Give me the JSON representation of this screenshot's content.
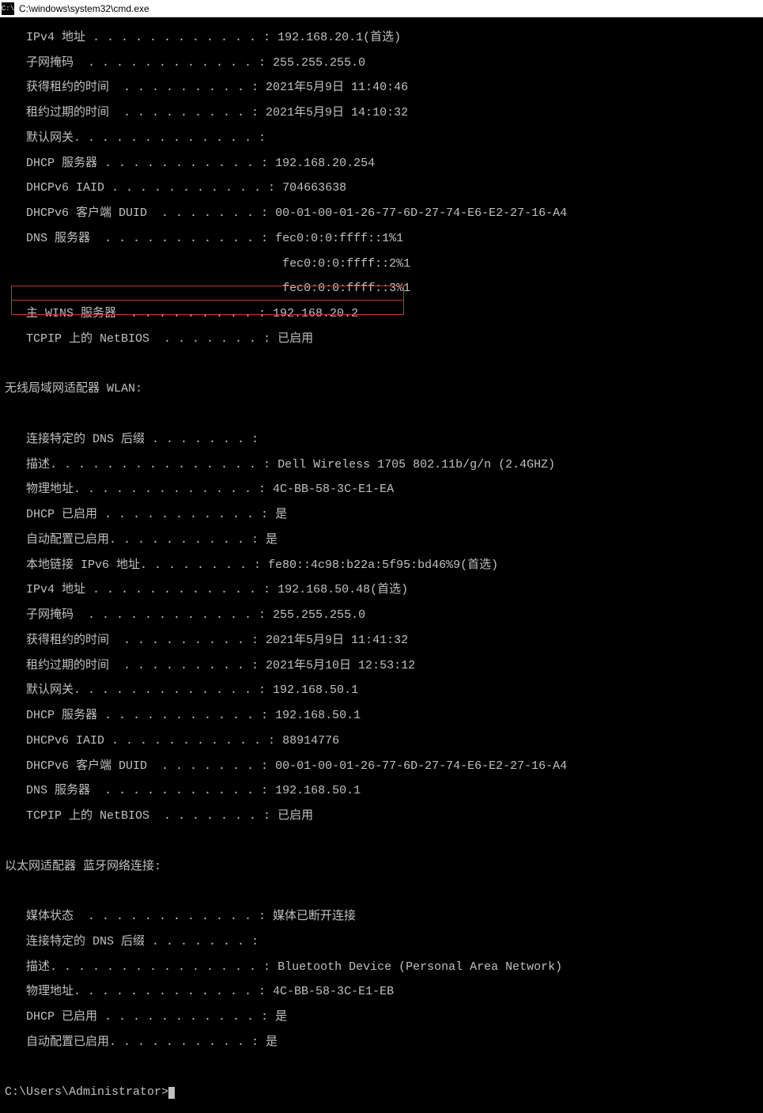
{
  "title": "C:\\windows\\system32\\cmd.exe",
  "adapter1": {
    "lines": [
      {
        "label": "   IPv4 地址 . . . . . . . . . . . . :",
        "value": " 192.168.20.1(首选)"
      },
      {
        "label": "   子网掩码  . . . . . . . . . . . . :",
        "value": " 255.255.255.0"
      },
      {
        "label": "   获得租约的时间  . . . . . . . . . :",
        "value": " 2021年5月9日 11:40:46"
      },
      {
        "label": "   租约过期的时间  . . . . . . . . . :",
        "value": " 2021年5月9日 14:10:32"
      },
      {
        "label": "   默认网关. . . . . . . . . . . . . :",
        "value": ""
      },
      {
        "label": "   DHCP 服务器 . . . . . . . . . . . :",
        "value": " 192.168.20.254"
      },
      {
        "label": "   DHCPv6 IAID . . . . . . . . . . . :",
        "value": " 704663638"
      },
      {
        "label": "   DHCPv6 客户端 DUID  . . . . . . . :",
        "value": " 00-01-00-01-26-77-6D-27-74-E6-E2-27-16-A4"
      },
      {
        "label": "   DNS 服务器  . . . . . . . . . . . :",
        "value": " fec0:0:0:ffff::1%1"
      },
      {
        "label": "                                      ",
        "value": " fec0:0:0:ffff::2%1"
      },
      {
        "label": "                                      ",
        "value": " fec0:0:0:ffff::3%1"
      },
      {
        "label": "   主 WINS 服务器  . . . . . . . . . :",
        "value": " 192.168.20.2"
      },
      {
        "label": "   TCPIP 上的 NetBIOS  . . . . . . . :",
        "value": " 已启用"
      }
    ]
  },
  "wlan_header": "无线局域网适配器 WLAN:",
  "adapter2": {
    "lines": [
      {
        "label": "   连接特定的 DNS 后缀 . . . . . . . :",
        "value": ""
      },
      {
        "label": "   描述. . . . . . . . . . . . . . . :",
        "value": " Dell Wireless 1705 802.11b/g/n (2.4GHZ)"
      },
      {
        "label": "   物理地址. . . . . . . . . . . . . :",
        "value": " 4C-BB-58-3C-E1-EA"
      },
      {
        "label": "   DHCP 已启用 . . . . . . . . . . . :",
        "value": " 是"
      },
      {
        "label": "   自动配置已启用. . . . . . . . . . :",
        "value": " 是"
      },
      {
        "label": "   本地链接 IPv6 地址. . . . . . . . :",
        "value": " fe80::4c98:b22a:5f95:bd46%9(首选)"
      },
      {
        "label": "   IPv4 地址 . . . . . . . . . . . . :",
        "value": " 192.168.50.48(首选)"
      },
      {
        "label": "   子网掩码  . . . . . . . . . . . . :",
        "value": " 255.255.255.0"
      },
      {
        "label": "   获得租约的时间  . . . . . . . . . :",
        "value": " 2021年5月9日 11:41:32"
      },
      {
        "label": "   租约过期的时间  . . . . . . . . . :",
        "value": " 2021年5月10日 12:53:12"
      },
      {
        "label": "   默认网关. . . . . . . . . . . . . :",
        "value": " 192.168.50.1"
      },
      {
        "label": "   DHCP 服务器 . . . . . . . . . . . :",
        "value": " 192.168.50.1"
      },
      {
        "label": "   DHCPv6 IAID . . . . . . . . . . . :",
        "value": " 88914776"
      },
      {
        "label": "   DHCPv6 客户端 DUID  . . . . . . . :",
        "value": " 00-01-00-01-26-77-6D-27-74-E6-E2-27-16-A4"
      },
      {
        "label": "   DNS 服务器  . . . . . . . . . . . :",
        "value": " 192.168.50.1"
      },
      {
        "label": "   TCPIP 上的 NetBIOS  . . . . . . . :",
        "value": " 已启用"
      }
    ]
  },
  "bt_header": "以太网适配器 蓝牙网络连接:",
  "adapter3": {
    "lines": [
      {
        "label": "   媒体状态  . . . . . . . . . . . . :",
        "value": " 媒体已断开连接"
      },
      {
        "label": "   连接特定的 DNS 后缀 . . . . . . . :",
        "value": ""
      },
      {
        "label": "   描述. . . . . . . . . . . . . . . :",
        "value": " Bluetooth Device (Personal Area Network)"
      },
      {
        "label": "   物理地址. . . . . . . . . . . . . :",
        "value": " 4C-BB-58-3C-E1-EB"
      },
      {
        "label": "   DHCP 已启用 . . . . . . . . . . . :",
        "value": " 是"
      },
      {
        "label": "   自动配置已启用. . . . . . . . . . :",
        "value": " 是"
      }
    ]
  },
  "prompt": "C:\\Users\\Administrator>"
}
